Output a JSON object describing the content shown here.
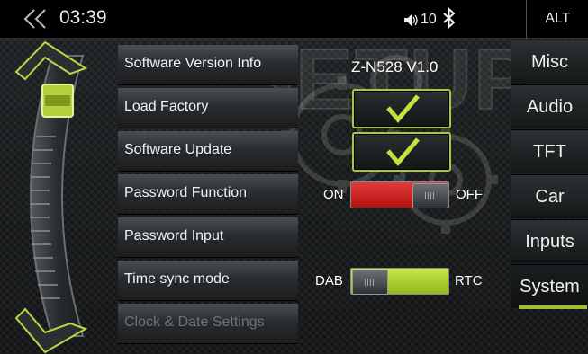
{
  "status": {
    "time": "03:39",
    "volume_level": "10",
    "alt_label": "ALT",
    "icons": [
      "back-chevron-icon",
      "volume-icon",
      "bluetooth-icon"
    ]
  },
  "watermark": "SETUP",
  "menu": {
    "items": [
      {
        "label": "Software Version Info",
        "value": "Z-N528 V1.0"
      },
      {
        "label": "Load Factory",
        "control": "check"
      },
      {
        "label": "Software Update",
        "control": "check"
      },
      {
        "label": "Password Function",
        "control": "toggle",
        "left": "ON",
        "right": "OFF",
        "state": "ON"
      },
      {
        "label": "Password Input"
      },
      {
        "label": "Time sync mode",
        "control": "toggle",
        "left": "DAB",
        "right": "RTC",
        "state": "RTC"
      },
      {
        "label": "Clock & Date Settings",
        "disabled": true
      }
    ]
  },
  "tabs": {
    "items": [
      "Misc",
      "Audio",
      "TFT",
      "Car",
      "Inputs",
      "System"
    ],
    "active": "System"
  },
  "colors": {
    "accent": "#9dc230",
    "toggle_on_red": "#cc2222",
    "toggle_green": "#b0d232",
    "bar_bg": "#000000"
  }
}
